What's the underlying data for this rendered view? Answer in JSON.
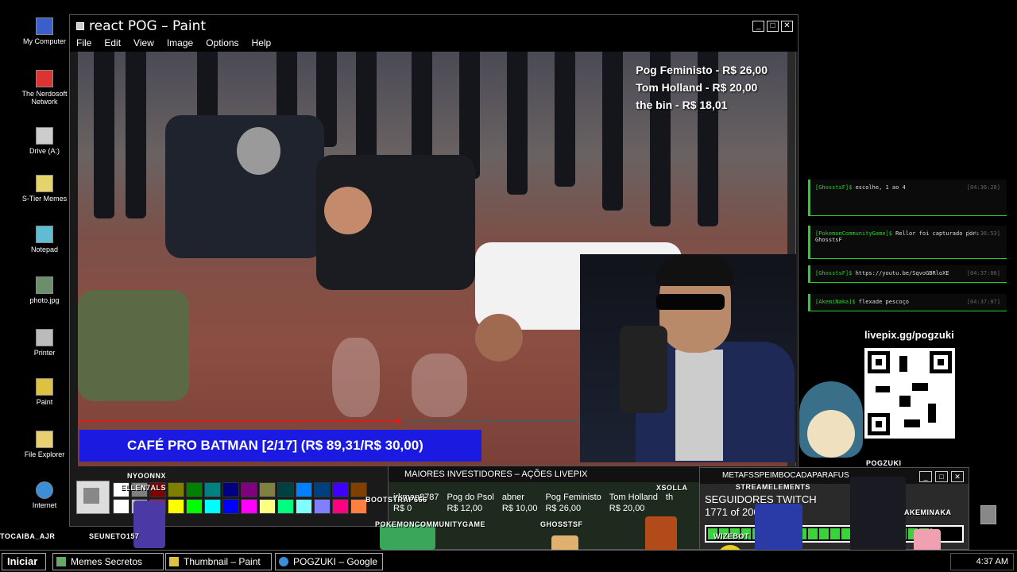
{
  "desktop": {
    "icons": [
      {
        "label": "My Computer"
      },
      {
        "label": "The Nerdosoft Network"
      },
      {
        "label": "Drive (A:)"
      },
      {
        "label": "S-Tier Memes"
      },
      {
        "label": "Notepad"
      },
      {
        "label": "photo.jpg"
      },
      {
        "label": "Printer"
      },
      {
        "label": "Paint"
      },
      {
        "label": "File Explorer"
      },
      {
        "label": "Internet"
      }
    ]
  },
  "paint": {
    "title": "react POG – Paint",
    "menu": [
      "File",
      "Edit",
      "View",
      "Image",
      "Options",
      "Help"
    ],
    "prices": [
      "Pog Feministo - R$ 26,00",
      "Tom Holland - R$ 20,00",
      "the bin - R$ 18,01"
    ],
    "banner": "CAFÉ PRO BATMAN [2/17] (R$ 89,31/R$ 30,00)",
    "video_progress": 0.63,
    "palette_colors": [
      "#ffffff",
      "#808080",
      "#800000",
      "#808000",
      "#008000",
      "#008080",
      "#000080",
      "#800080",
      "#808040",
      "#004040",
      "#0080ff",
      "#004080",
      "#4000ff",
      "#804000",
      "#ffffff",
      "#c0c0c0",
      "#ff0000",
      "#ffff00",
      "#00ff00",
      "#00ffff",
      "#0000ff",
      "#ff00ff",
      "#ffff80",
      "#00ff80",
      "#80ffff",
      "#8080ff",
      "#ff0080",
      "#ff8040"
    ]
  },
  "chat": [
    {
      "user": "[GhosstsF]$",
      "text": "escolhe, 1 ao 4",
      "time": "[04:36:28]"
    },
    {
      "user": "[PokemonCommunityGame]$",
      "text": "Rellor foi capturado por: GhosstsF",
      "time": "[04:36:53]"
    },
    {
      "user": "[GhosstsF]$",
      "text": "https://youtu.be/SqvoGBRloXE",
      "time": "[04:37:00]"
    },
    {
      "user": "[AkemiNaka]$",
      "text": "flexade pescoço",
      "time": "[04:37:07]"
    }
  ],
  "livepix": {
    "url": "livepix.gg/pogzuki"
  },
  "investors": {
    "title": "MAIORES INVESTIDORES – AÇÕES LIVEPIX",
    "columns": [
      {
        "name": "irkman8787",
        "value": "R$ 0"
      },
      {
        "name": "Pog do Psol",
        "value": "R$ 12,00"
      },
      {
        "name": "abner",
        "value": "R$ 10,00"
      },
      {
        "name": "Pog Feministo",
        "value": "R$ 26,00"
      },
      {
        "name": "Tom Holland",
        "value": "R$ 20,00"
      },
      {
        "name": "th",
        "value": ""
      }
    ]
  },
  "seguidores": {
    "header": "METAFSSPEIMBOCADAPARAFUS",
    "title": "SEGUIDORES TWITCH",
    "count": "1771 of 2000",
    "progress": 0.8855
  },
  "sprite_tags": [
    "NYOONNX",
    "ELLEN7ALS",
    "BOOTSTRAP666",
    "POKEMONCOMMUNITYGAME",
    "GHOSSTSF",
    "SEUNETO157",
    "TOCAIBA_AJR",
    "XSOLLA",
    "STREAMELEMENTS",
    "AKEMINAKA",
    "WIZEBOT",
    "POGZUKI"
  ],
  "taskbar": {
    "start": "Iniciar",
    "items": [
      {
        "label": "Memes Secretos"
      },
      {
        "label": "Thumbnail – Paint"
      },
      {
        "label": "POGZUKI – Google"
      }
    ],
    "clock": "4:37 AM"
  }
}
